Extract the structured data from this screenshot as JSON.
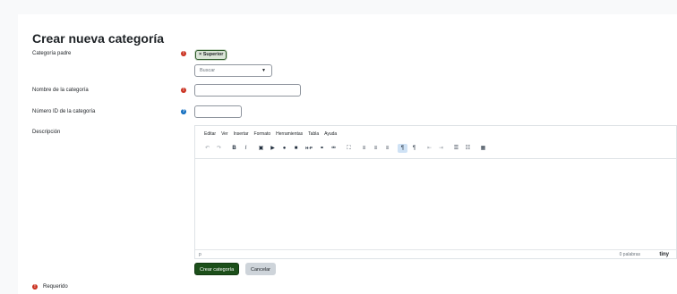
{
  "page": {
    "title": "Crear nueva categoría"
  },
  "form": {
    "parent_label": "Categoría padre",
    "parent_tag": "× Superior",
    "search_placeholder": "Buscar",
    "name_label": "Nombre de la categoría",
    "name_value": "",
    "idnumber_label": "Número ID de la categoría",
    "idnumber_value": "",
    "description_label": "Descripción"
  },
  "editor": {
    "menu": [
      "Editar",
      "Ver",
      "Insertar",
      "Formato",
      "Herramientas",
      "Tabla",
      "Ayuda"
    ],
    "toolbar_icons": [
      {
        "name": "undo-icon",
        "glyph": "↶"
      },
      {
        "name": "redo-icon",
        "glyph": "↷"
      },
      {
        "name": "bold-icon",
        "glyph": "B"
      },
      {
        "name": "italic-icon",
        "glyph": "I"
      },
      {
        "name": "image-icon",
        "glyph": "▣"
      },
      {
        "name": "media-icon",
        "glyph": "▶"
      },
      {
        "name": "microphone-icon",
        "glyph": "●"
      },
      {
        "name": "video-camera-icon",
        "glyph": "■"
      },
      {
        "name": "h5p-icon",
        "glyph": "H-P"
      },
      {
        "name": "link-icon",
        "glyph": "⚭"
      },
      {
        "name": "unlink-icon",
        "glyph": "⚮"
      },
      {
        "name": "fullscreen-icon",
        "glyph": "⛶"
      },
      {
        "name": "align-left-icon",
        "glyph": "≡"
      },
      {
        "name": "align-center-icon",
        "glyph": "≡"
      },
      {
        "name": "align-right-icon",
        "glyph": "≡"
      },
      {
        "name": "ltr-icon",
        "glyph": "¶"
      },
      {
        "name": "rtl-icon",
        "glyph": "¶"
      },
      {
        "name": "outdent-icon",
        "glyph": "⇤"
      },
      {
        "name": "indent-icon",
        "glyph": "⇥"
      },
      {
        "name": "bullet-list-icon",
        "glyph": "☰"
      },
      {
        "name": "numbered-list-icon",
        "glyph": "☷"
      },
      {
        "name": "calculator-icon",
        "glyph": "▦"
      }
    ],
    "status_path": "p",
    "word_count": "0 palabras",
    "brand": "tiny"
  },
  "buttons": {
    "submit": "Crear categoría",
    "cancel": "Cancelar"
  },
  "legend": {
    "required": "Requerido"
  },
  "colors": {
    "required": "#ca3120",
    "info": "#0f6cbf",
    "primary": "#1c4f1a"
  }
}
